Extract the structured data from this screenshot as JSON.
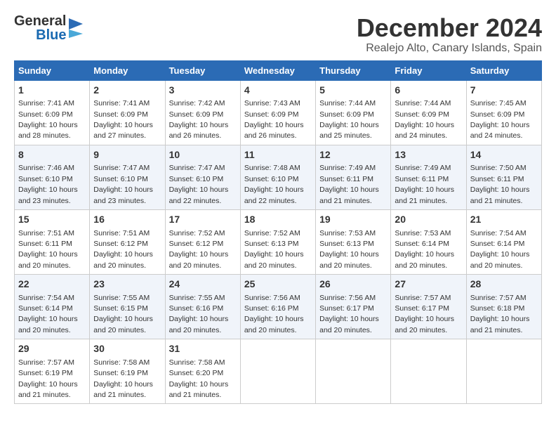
{
  "logo": {
    "general": "General",
    "blue": "Blue"
  },
  "title": "December 2024",
  "location": "Realejo Alto, Canary Islands, Spain",
  "days_of_week": [
    "Sunday",
    "Monday",
    "Tuesday",
    "Wednesday",
    "Thursday",
    "Friday",
    "Saturday"
  ],
  "weeks": [
    [
      {
        "day": "1",
        "sunrise": "7:41 AM",
        "sunset": "6:09 PM",
        "daylight": "10 hours and 28 minutes."
      },
      {
        "day": "2",
        "sunrise": "7:41 AM",
        "sunset": "6:09 PM",
        "daylight": "10 hours and 27 minutes."
      },
      {
        "day": "3",
        "sunrise": "7:42 AM",
        "sunset": "6:09 PM",
        "daylight": "10 hours and 26 minutes."
      },
      {
        "day": "4",
        "sunrise": "7:43 AM",
        "sunset": "6:09 PM",
        "daylight": "10 hours and 26 minutes."
      },
      {
        "day": "5",
        "sunrise": "7:44 AM",
        "sunset": "6:09 PM",
        "daylight": "10 hours and 25 minutes."
      },
      {
        "day": "6",
        "sunrise": "7:44 AM",
        "sunset": "6:09 PM",
        "daylight": "10 hours and 24 minutes."
      },
      {
        "day": "7",
        "sunrise": "7:45 AM",
        "sunset": "6:09 PM",
        "daylight": "10 hours and 24 minutes."
      }
    ],
    [
      {
        "day": "8",
        "sunrise": "7:46 AM",
        "sunset": "6:10 PM",
        "daylight": "10 hours and 23 minutes."
      },
      {
        "day": "9",
        "sunrise": "7:47 AM",
        "sunset": "6:10 PM",
        "daylight": "10 hours and 23 minutes."
      },
      {
        "day": "10",
        "sunrise": "7:47 AM",
        "sunset": "6:10 PM",
        "daylight": "10 hours and 22 minutes."
      },
      {
        "day": "11",
        "sunrise": "7:48 AM",
        "sunset": "6:10 PM",
        "daylight": "10 hours and 22 minutes."
      },
      {
        "day": "12",
        "sunrise": "7:49 AM",
        "sunset": "6:11 PM",
        "daylight": "10 hours and 21 minutes."
      },
      {
        "day": "13",
        "sunrise": "7:49 AM",
        "sunset": "6:11 PM",
        "daylight": "10 hours and 21 minutes."
      },
      {
        "day": "14",
        "sunrise": "7:50 AM",
        "sunset": "6:11 PM",
        "daylight": "10 hours and 21 minutes."
      }
    ],
    [
      {
        "day": "15",
        "sunrise": "7:51 AM",
        "sunset": "6:11 PM",
        "daylight": "10 hours and 20 minutes."
      },
      {
        "day": "16",
        "sunrise": "7:51 AM",
        "sunset": "6:12 PM",
        "daylight": "10 hours and 20 minutes."
      },
      {
        "day": "17",
        "sunrise": "7:52 AM",
        "sunset": "6:12 PM",
        "daylight": "10 hours and 20 minutes."
      },
      {
        "day": "18",
        "sunrise": "7:52 AM",
        "sunset": "6:13 PM",
        "daylight": "10 hours and 20 minutes."
      },
      {
        "day": "19",
        "sunrise": "7:53 AM",
        "sunset": "6:13 PM",
        "daylight": "10 hours and 20 minutes."
      },
      {
        "day": "20",
        "sunrise": "7:53 AM",
        "sunset": "6:14 PM",
        "daylight": "10 hours and 20 minutes."
      },
      {
        "day": "21",
        "sunrise": "7:54 AM",
        "sunset": "6:14 PM",
        "daylight": "10 hours and 20 minutes."
      }
    ],
    [
      {
        "day": "22",
        "sunrise": "7:54 AM",
        "sunset": "6:14 PM",
        "daylight": "10 hours and 20 minutes."
      },
      {
        "day": "23",
        "sunrise": "7:55 AM",
        "sunset": "6:15 PM",
        "daylight": "10 hours and 20 minutes."
      },
      {
        "day": "24",
        "sunrise": "7:55 AM",
        "sunset": "6:16 PM",
        "daylight": "10 hours and 20 minutes."
      },
      {
        "day": "25",
        "sunrise": "7:56 AM",
        "sunset": "6:16 PM",
        "daylight": "10 hours and 20 minutes."
      },
      {
        "day": "26",
        "sunrise": "7:56 AM",
        "sunset": "6:17 PM",
        "daylight": "10 hours and 20 minutes."
      },
      {
        "day": "27",
        "sunrise": "7:57 AM",
        "sunset": "6:17 PM",
        "daylight": "10 hours and 20 minutes."
      },
      {
        "day": "28",
        "sunrise": "7:57 AM",
        "sunset": "6:18 PM",
        "daylight": "10 hours and 21 minutes."
      }
    ],
    [
      {
        "day": "29",
        "sunrise": "7:57 AM",
        "sunset": "6:19 PM",
        "daylight": "10 hours and 21 minutes."
      },
      {
        "day": "30",
        "sunrise": "7:58 AM",
        "sunset": "6:19 PM",
        "daylight": "10 hours and 21 minutes."
      },
      {
        "day": "31",
        "sunrise": "7:58 AM",
        "sunset": "6:20 PM",
        "daylight": "10 hours and 21 minutes."
      },
      null,
      null,
      null,
      null
    ]
  ]
}
